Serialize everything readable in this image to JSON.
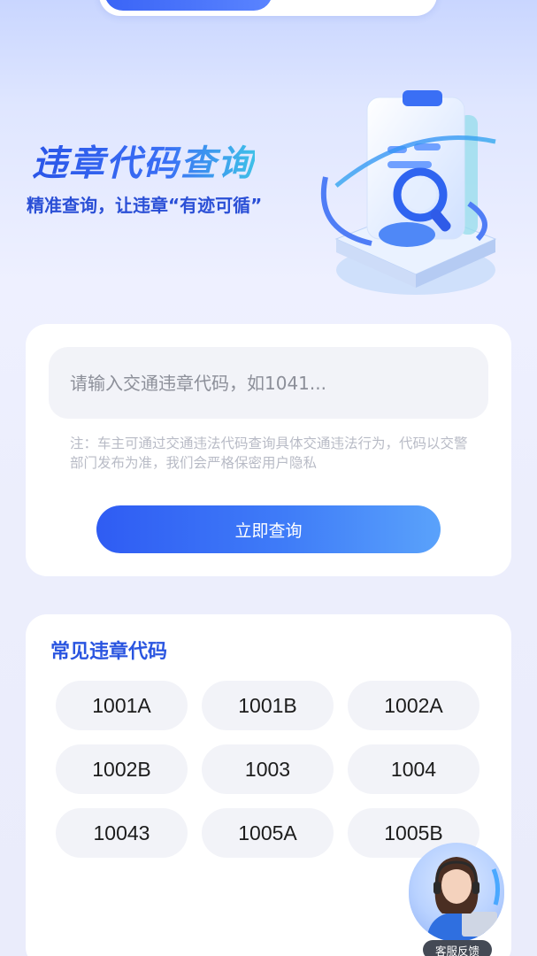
{
  "hero": {
    "title": "违章代码查询",
    "subtitle": "精准查询，让违章“有迹可循”"
  },
  "query": {
    "placeholder": "请输入交通违章代码，如1041...",
    "note": "注：车主可通过交通违法代码查询具体交通违法行为，代码以交警部门发布为准，我们会严格保密用户隐私",
    "button_label": "立即查询"
  },
  "codes": {
    "title": "常见违章代码",
    "items": [
      "1001A",
      "1001B",
      "1002A",
      "1002B",
      "1003",
      "1004",
      "10043",
      "1005A",
      "1005B"
    ]
  },
  "customer_service": {
    "label": "客服反馈"
  },
  "colors": {
    "accent": "#2f5cf3",
    "title_blue": "#2a55e0",
    "chip_bg": "#f2f3f8"
  }
}
